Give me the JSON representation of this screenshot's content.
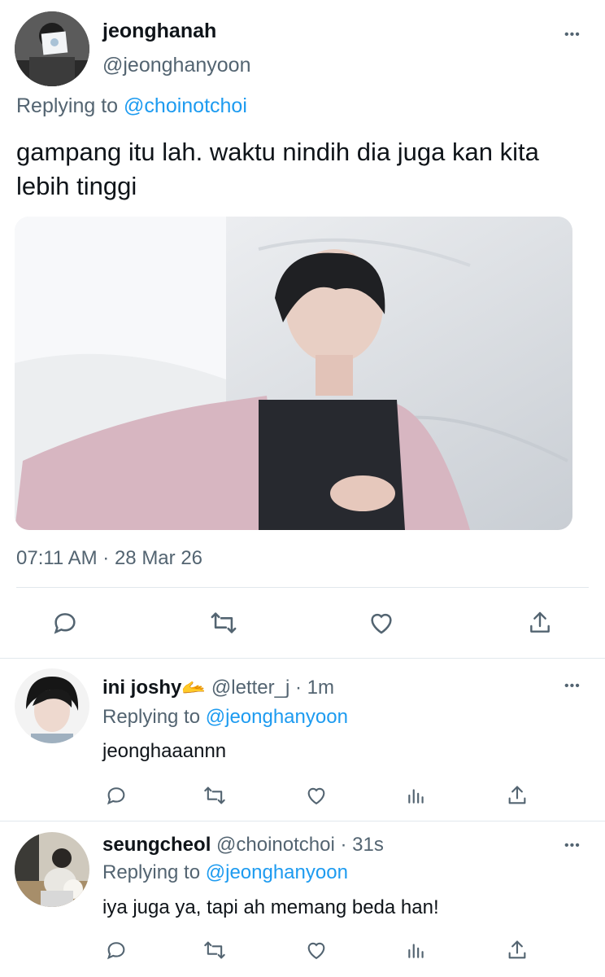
{
  "main_tweet": {
    "display_name": "jeonghanah",
    "handle": "@jeonghanyoon",
    "replying_prefix": "Replying to",
    "replying_to": "@choinotchoi",
    "text": "gampang itu lah. waktu nindih dia juga kan kita lebih tinggi",
    "timestamp": "07:11 AM · 28 Mar 26",
    "actions": [
      "reply-icon",
      "retweet-icon",
      "like-icon",
      "share-icon"
    ]
  },
  "replies": [
    {
      "display_name": "ini joshy",
      "emoji": "🫴",
      "handle": "@letter_j",
      "time": "· 1m",
      "replying_prefix": "Replying to",
      "replying_to": "@jeonghanyoon",
      "text": "jeonghaaannn"
    },
    {
      "display_name": "seungcheol",
      "handle": "@choinotchoi",
      "time": "· 31s",
      "replying_prefix": "Replying to",
      "replying_to": "@jeonghanyoon",
      "text": "iya juga ya, tapi ah memang beda han!"
    }
  ],
  "more_label": "•••",
  "colors": {
    "link": "#1d9bf0",
    "secondary": "#536471",
    "text": "#0f1419",
    "divider": "#e1e8ed"
  }
}
